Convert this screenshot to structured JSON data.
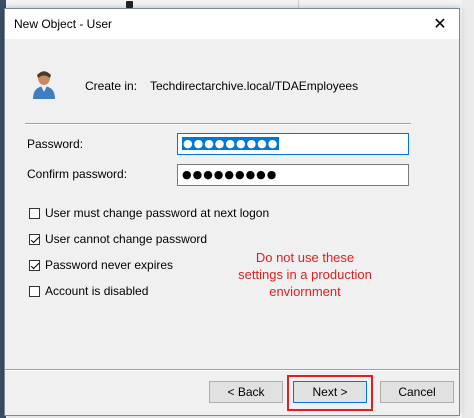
{
  "window": {
    "title": "New Object - User",
    "close_glyph": "✕"
  },
  "header": {
    "create_in_label": "Create in:",
    "create_in_path": "Techdirectarchive.local/TDAEmployees",
    "icon": "user-icon"
  },
  "password": {
    "label": "Password:",
    "masked_value": "●●●●●●●●●",
    "selected": true
  },
  "confirm_password": {
    "label": "Confirm password:",
    "masked_value": "●●●●●●●●●"
  },
  "options": [
    {
      "label": "User must change password at next logon",
      "checked": false
    },
    {
      "label": "User cannot change password",
      "checked": true
    },
    {
      "label": "Password never expires",
      "checked": true
    },
    {
      "label": "Account is disabled",
      "checked": false
    }
  ],
  "annotation": {
    "text": "Do not use these settings in a production enviornment",
    "color": "#e02020"
  },
  "buttons": {
    "back": "< Back",
    "next": "Next >",
    "cancel": "Cancel"
  },
  "colors": {
    "accent": "#0078d7",
    "highlight": "#e02020"
  }
}
